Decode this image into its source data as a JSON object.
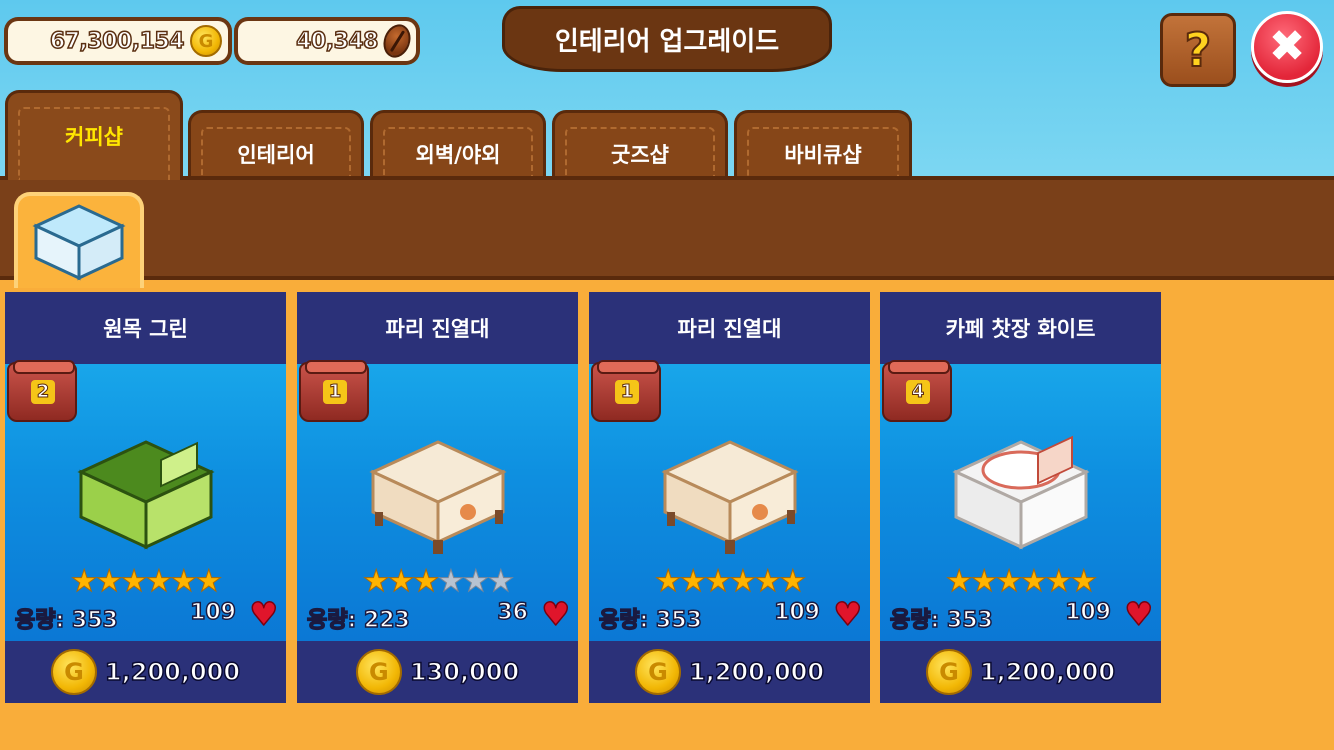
{
  "currency": {
    "coins": "67,300,154",
    "beans": "40,348"
  },
  "title": "인테리어 업그레이드",
  "buttons": {
    "help_label": "?",
    "close_label": "✖"
  },
  "tabs": [
    {
      "label": "커피샵",
      "active": true
    },
    {
      "label": "인테리어",
      "active": false
    },
    {
      "label": "외벽/야외",
      "active": false
    },
    {
      "label": "굿즈샵",
      "active": false
    },
    {
      "label": "바비큐샵",
      "active": false
    }
  ],
  "items": [
    {
      "name": "원목 그린",
      "level": "2",
      "stars": 6,
      "max_stars": 6,
      "capacity": "용량: 353",
      "likes": "109",
      "price": "1,200,000",
      "color": "green"
    },
    {
      "name": "파리 진열대",
      "level": "1",
      "stars": 3,
      "max_stars": 6,
      "capacity": "용량: 223",
      "likes": "36",
      "price": "130,000",
      "color": "cream"
    },
    {
      "name": "파리 진열대",
      "level": "1",
      "stars": 6,
      "max_stars": 6,
      "capacity": "용량: 353",
      "likes": "109",
      "price": "1,200,000",
      "color": "cream"
    },
    {
      "name": "카페 찻장 화이트",
      "level": "4",
      "stars": 6,
      "max_stars": 6,
      "capacity": "용량: 353",
      "likes": "109",
      "price": "1,200,000",
      "color": "white"
    }
  ]
}
